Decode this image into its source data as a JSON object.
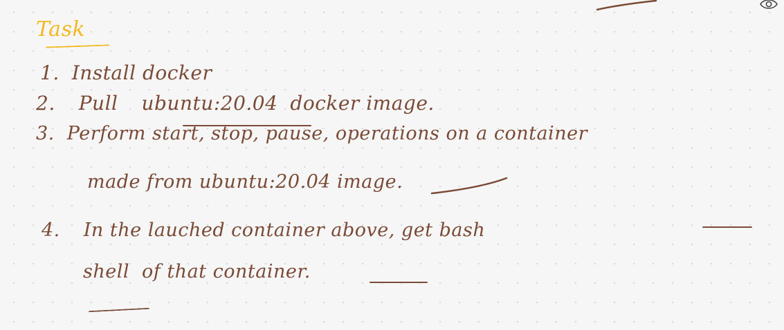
{
  "title": "Task",
  "lines": {
    "l1": {
      "num": "1.",
      "text": "Install docker"
    },
    "l2": {
      "num": "2.",
      "pull": "Pull",
      "image": "ubuntu:20.04",
      "rest": "docker image."
    },
    "l3": {
      "num": "3.",
      "text": "Perform start, stop, pause, operations on a container"
    },
    "l3b": {
      "text": "made from ubuntu:20.04 image."
    },
    "l4": {
      "num": "4.",
      "text": "In the lauched container above, get bash"
    },
    "l4b": {
      "shell": "shell",
      "rest": "of that container."
    }
  },
  "colors": {
    "ink": "#7a4a36",
    "title": "#f2b81f",
    "background": "#f6f6f6"
  },
  "icons": [
    "eye-icon"
  ]
}
